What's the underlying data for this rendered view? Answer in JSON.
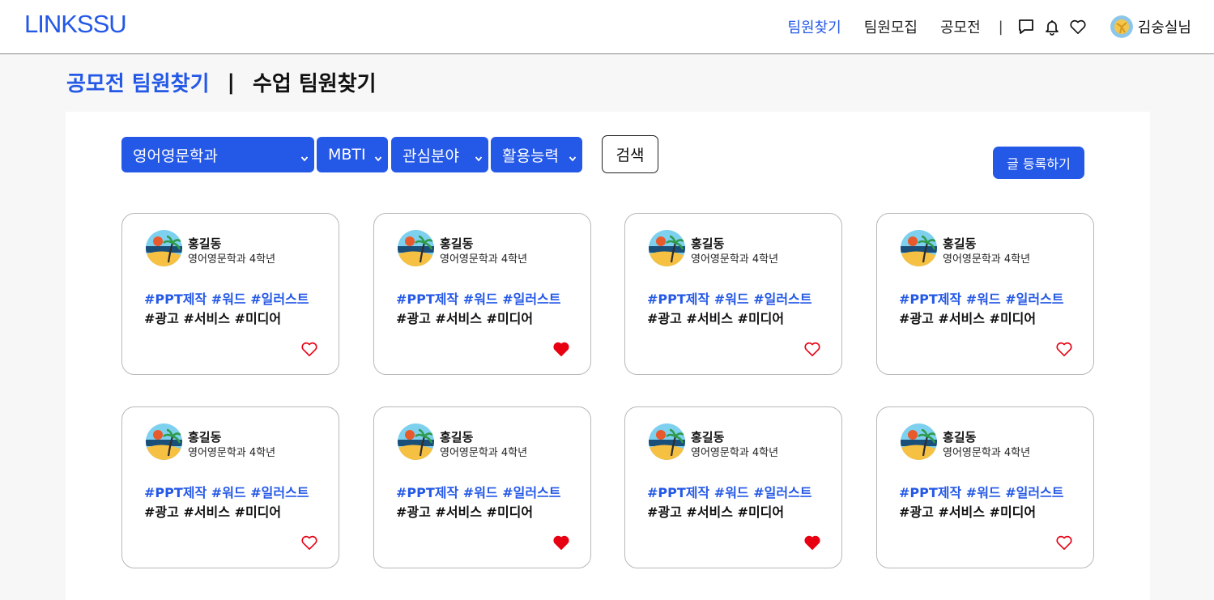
{
  "header": {
    "logo": "LINKSSU",
    "nav": [
      {
        "label": "팀원찾기",
        "active": true
      },
      {
        "label": "팀원모집",
        "active": false
      },
      {
        "label": "공모전",
        "active": false
      }
    ],
    "separator": "|",
    "icons": [
      "chat-icon",
      "bell-icon",
      "heart-icon"
    ],
    "user_name": "김숭실님"
  },
  "tabs": [
    {
      "label": "공모전 팀원찾기",
      "active": true
    },
    {
      "label": "수업 팀원찾기",
      "active": false
    }
  ],
  "tab_separator": "|",
  "filters": [
    {
      "selected": "영어영문학과"
    },
    {
      "selected": "MBTI"
    },
    {
      "selected": "관심분야"
    },
    {
      "selected": "활용능력"
    }
  ],
  "search_label": "검색",
  "write_label": "글 등록하기",
  "cards": [
    {
      "name": "홍길동",
      "dept": "영어영문학과 4학년",
      "skills": "#PPT제작 #워드 #일러스트",
      "interests": "#광고 #서비스 #미디어",
      "liked": false
    },
    {
      "name": "홍길동",
      "dept": "영어영문학과 4학년",
      "skills": "#PPT제작 #워드 #일러스트",
      "interests": "#광고 #서비스 #미디어",
      "liked": true
    },
    {
      "name": "홍길동",
      "dept": "영어영문학과 4학년",
      "skills": "#PPT제작 #워드 #일러스트",
      "interests": "#광고 #서비스 #미디어",
      "liked": false
    },
    {
      "name": "홍길동",
      "dept": "영어영문학과 4학년",
      "skills": "#PPT제작 #워드 #일러스트",
      "interests": "#광고 #서비스 #미디어",
      "liked": false
    },
    {
      "name": "홍길동",
      "dept": "영어영문학과 4학년",
      "skills": "#PPT제작 #워드 #일러스트",
      "interests": "#광고 #서비스 #미디어",
      "liked": false
    },
    {
      "name": "홍길동",
      "dept": "영어영문학과 4학년",
      "skills": "#PPT제작 #워드 #일러스트",
      "interests": "#광고 #서비스 #미디어",
      "liked": true
    },
    {
      "name": "홍길동",
      "dept": "영어영문학과 4학년",
      "skills": "#PPT제작 #워드 #일러스트",
      "interests": "#광고 #서비스 #미디어",
      "liked": true
    },
    {
      "name": "홍길동",
      "dept": "영어영문학과 4학년",
      "skills": "#PPT제작 #워드 #일러스트",
      "interests": "#광고 #서비스 #미디어",
      "liked": false
    }
  ],
  "colors": {
    "accent": "#2458e6",
    "heart_filled": "#e60012",
    "heart_outline": "#e60012"
  }
}
